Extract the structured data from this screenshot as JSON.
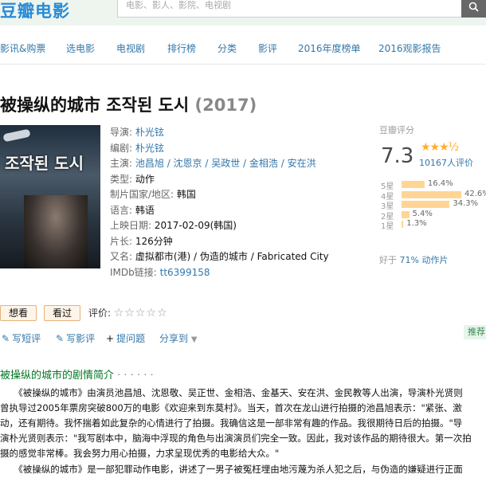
{
  "site": {
    "logo": "豆瓣电影",
    "search_placeholder": "电影、影人、影院、电视剧"
  },
  "nav": [
    "影讯&购票",
    "选电影",
    "电视剧",
    "排行榜",
    "分类",
    "影评",
    "2016年度榜单",
    "2016观影报告"
  ],
  "movie": {
    "title": "被操纵的城市 조작된 도시",
    "year": "(2017)",
    "poster_text": "조작된 도시",
    "info": [
      {
        "label": "导演:",
        "value": "朴光铉"
      },
      {
        "label": "编剧:",
        "value": "朴光铉"
      },
      {
        "label": "主演:",
        "value": "池昌旭 / 沈恩京 / 吴政世 / 金相浩 / 安在洪"
      },
      {
        "label": "类型:",
        "value": "动作"
      },
      {
        "label": "制片国家/地区:",
        "value": "韩国"
      },
      {
        "label": "语言:",
        "value": "韩语"
      },
      {
        "label": "上映日期:",
        "value": "2017-02-09(韩国)"
      },
      {
        "label": "片长:",
        "value": "126分钟"
      },
      {
        "label": "又名:",
        "value": "虚拟都市(港) / 伪造的城市 / Fabricated City"
      },
      {
        "label": "IMDb链接:",
        "value": "tt6399158"
      }
    ]
  },
  "rating": {
    "label": "豆瓣评分",
    "score": "7.3",
    "stars": "★★★½",
    "votes": "10167人评价",
    "distribution": [
      {
        "label": "5星",
        "percent": 16.4,
        "text": "16.4%"
      },
      {
        "label": "4星",
        "percent": 42.6,
        "text": "42.6%"
      },
      {
        "label": "3星",
        "percent": 34.3,
        "text": "34.3%"
      },
      {
        "label": "2星",
        "percent": 5.4,
        "text": "5.4%"
      },
      {
        "label": "1星",
        "percent": 1.3,
        "text": "1.3%"
      }
    ],
    "better_than_prefix": "好于",
    "better_than_link": "71% 动作片"
  },
  "actions": {
    "want": "想看",
    "seen": "看过",
    "eval_label": "评价:",
    "eval_stars": "☆☆☆☆☆",
    "short_review": "写短评",
    "review": "写影评",
    "question": "提问题",
    "share": "分享到",
    "recommend": "推荐"
  },
  "summary": {
    "title": "被操纵的城市的剧情简介",
    "dots": " · · · · · ·",
    "lines": [
      "　　《被操纵的城市》由演员池昌旭、沈恩敬、吴正世、金相浩、金基天、安在洪、金民教等人出演，导演朴光贤则",
      "曾执导过2005年票房突破800万的电影《欢迎来到东莫村》。当天，首次在龙山进行拍摄的池昌旭表示：\"紧张、激",
      "动，还有期待。我怀揣着如此复杂的心情进行了拍摄。我确信这是一部非常有趣的作品。我很期待日后的拍摄。\"导",
      "演朴光贤则表示：\"我写剧本中，脑海中浮现的角色与出演演员们完全一致。因此，我对该作品的期待很大。第一次拍",
      "摄的感觉非常棒。我会努力用心拍摄，力求呈现优秀的电影给大众。\"",
      "　　《被操纵的城市》是一部犯罪动作电影，讲述了一男子被冤枉埋由地污蔑为杀人犯之后，与伪造的嫌疑进行正面"
    ]
  }
}
